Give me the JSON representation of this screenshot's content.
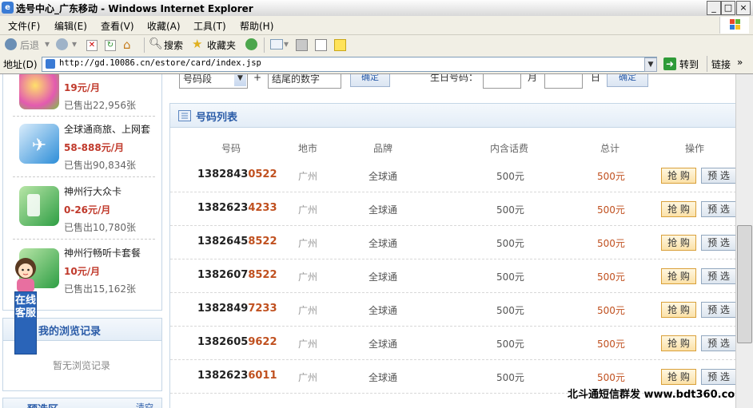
{
  "window": {
    "title": "选号中心_广东移动 - Windows Internet Explorer",
    "buttons": [
      "_",
      "□",
      "×"
    ]
  },
  "menu": [
    "文件(F)",
    "编辑(E)",
    "查看(V)",
    "收藏(A)",
    "工具(T)",
    "帮助(H)"
  ],
  "toolbar": {
    "back": "后退",
    "search": "搜索",
    "favorites": "收藏夹"
  },
  "address": {
    "label": "地址(D)",
    "url": "http://gd.10086.cn/estore/card/index.jsp",
    "go": "转到",
    "links": "链接"
  },
  "top_form": {
    "select_value": "号码段",
    "plus": "+",
    "tail_input": "结尾的数字",
    "search_btn": "确定",
    "birthday_label": "生日号码：",
    "month": "月",
    "day": "日",
    "birthday_btn": "确定"
  },
  "products": [
    {
      "name": "",
      "price": "19元/月",
      "sold": "已售出22,956张"
    },
    {
      "name": "全球通商旅、上网套",
      "price": "58-888元/月",
      "sold": "已售出90,834张"
    },
    {
      "name": "神州行大众卡",
      "price": "0-26元/月",
      "sold": "已售出10,780张"
    },
    {
      "name": "神州行畅听卡套餐",
      "price": "10元/月",
      "sold": "已售出15,162张"
    }
  ],
  "history": {
    "title": "我的浏览记录",
    "empty": "暂无浏览记录"
  },
  "presel": {
    "title": "预选区",
    "clear": "清空"
  },
  "chat": {
    "label": "在线客服"
  },
  "numlist": {
    "title": "号码列表",
    "columns": [
      "号码",
      "地市",
      "品牌",
      "内含话费",
      "总计",
      "操作"
    ],
    "grab_label": "抢 购",
    "pre_label": "预 选",
    "rows": [
      {
        "prefix": "1382843",
        "tail": "0522",
        "city": "广州",
        "brand": "全球通",
        "fee": "500元",
        "total": "500元"
      },
      {
        "prefix": "1382623",
        "tail": "4233",
        "city": "广州",
        "brand": "全球通",
        "fee": "500元",
        "total": "500元"
      },
      {
        "prefix": "1382645",
        "tail": "8522",
        "city": "广州",
        "brand": "全球通",
        "fee": "500元",
        "total": "500元"
      },
      {
        "prefix": "1382607",
        "tail": "8522",
        "city": "广州",
        "brand": "全球通",
        "fee": "500元",
        "total": "500元"
      },
      {
        "prefix": "1382849",
        "tail": "7233",
        "city": "广州",
        "brand": "全球通",
        "fee": "500元",
        "total": "500元"
      },
      {
        "prefix": "1382605",
        "tail": "9622",
        "city": "广州",
        "brand": "全球通",
        "fee": "500元",
        "total": "500元"
      },
      {
        "prefix": "1382623",
        "tail": "6011",
        "city": "广州",
        "brand": "全球通",
        "fee": "500元",
        "total": "500元"
      }
    ]
  },
  "watermark": "北斗通短信群发 www.bdt360.com"
}
